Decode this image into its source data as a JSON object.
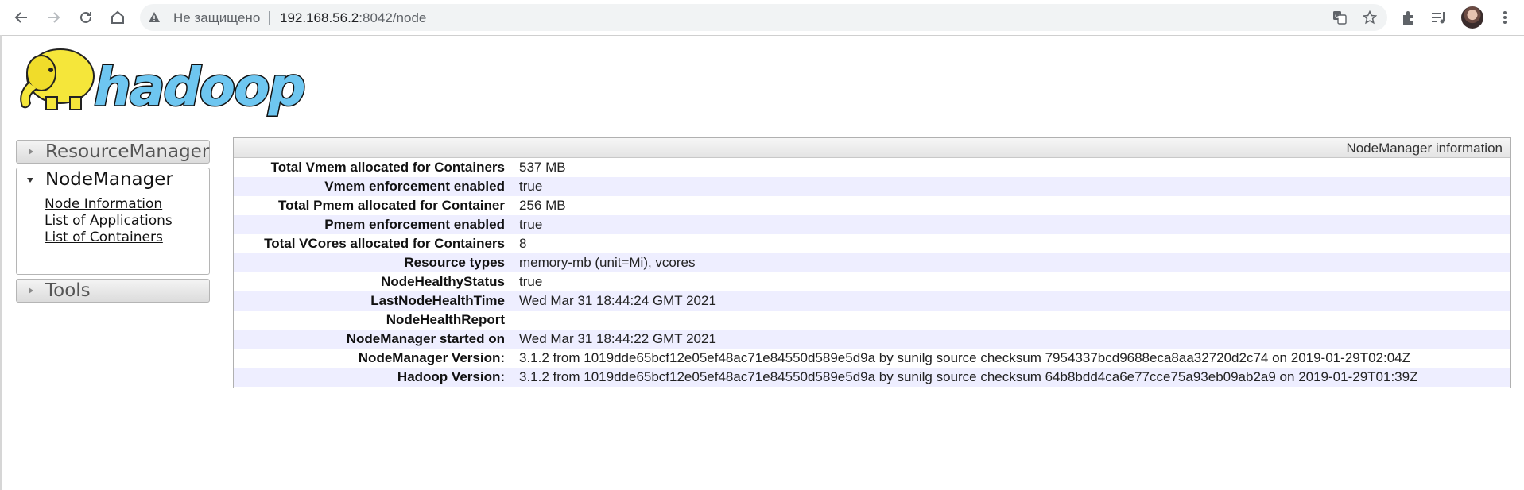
{
  "browser": {
    "insecure_label": "Не защищено",
    "url_host": "192.168.56.2",
    "url_path": ":8042/node"
  },
  "logo": {
    "text": "hadoop"
  },
  "sidebar": {
    "sections": [
      {
        "label": "ResourceManager",
        "expanded": false
      },
      {
        "label": "NodeManager",
        "expanded": true,
        "links": [
          "Node Information",
          "List of Applications",
          "List of Containers"
        ]
      },
      {
        "label": "Tools",
        "expanded": false
      }
    ]
  },
  "info": {
    "title": "NodeManager information",
    "rows": [
      {
        "label": "Total Vmem allocated for Containers",
        "value": "537 MB"
      },
      {
        "label": "Vmem enforcement enabled",
        "value": "true"
      },
      {
        "label": "Total Pmem allocated for Container",
        "value": "256 MB"
      },
      {
        "label": "Pmem enforcement enabled",
        "value": "true"
      },
      {
        "label": "Total VCores allocated for Containers",
        "value": "8"
      },
      {
        "label": "Resource types",
        "value": "memory-mb (unit=Mi), vcores"
      },
      {
        "label": "NodeHealthyStatus",
        "value": "true"
      },
      {
        "label": "LastNodeHealthTime",
        "value": "Wed Mar 31 18:44:24 GMT 2021"
      },
      {
        "label": "NodeHealthReport",
        "value": ""
      },
      {
        "label": "NodeManager started on",
        "value": "Wed Mar 31 18:44:22 GMT 2021"
      },
      {
        "label": "NodeManager Version:",
        "value": "3.1.2 from 1019dde65bcf12e05ef48ac71e84550d589e5d9a by sunilg source checksum 7954337bcd9688eca8aa32720d2c74 on 2019-01-29T02:04Z"
      },
      {
        "label": "Hadoop Version:",
        "value": "3.1.2 from 1019dde65bcf12e05ef48ac71e84550d589e5d9a by sunilg source checksum 64b8bdd4ca6e77cce75a93eb09ab2a9 on 2019-01-29T01:39Z"
      }
    ]
  },
  "colors": {
    "row_alt": "#eeeeff",
    "logo_yellow": "#f5e63a",
    "logo_blue": "#6ec6f0"
  }
}
